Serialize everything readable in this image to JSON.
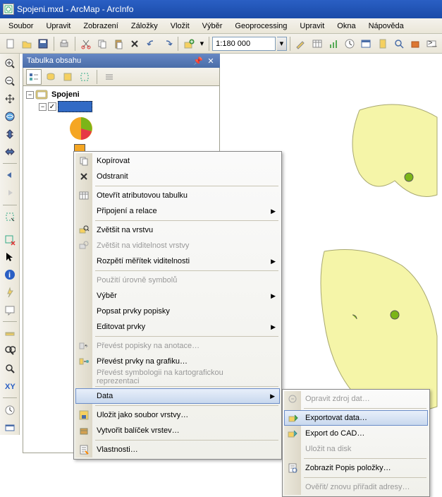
{
  "window": {
    "title": "Spojeni.mxd - ArcMap - ArcInfo"
  },
  "menubar": [
    "Soubor",
    "Upravit",
    "Zobrazení",
    "Záložky",
    "Vložit",
    "Výběr",
    "Geoprocessing",
    "Upravit",
    "Okna",
    "Nápověda"
  ],
  "toolbar": {
    "scale": "1:180 000"
  },
  "toc": {
    "title": "Tabulka obsahu",
    "root": "Spojeni",
    "layer": "",
    "legend": {
      "colors": [
        "#f5a623",
        "#e63946",
        "#7cb518"
      ]
    }
  },
  "context_menu1": {
    "items": [
      {
        "label": "Kopírovat",
        "icon": "copy-icon"
      },
      {
        "label": "Odstranit",
        "icon": "delete-icon"
      },
      {
        "sep": true
      },
      {
        "label": "Otevřít atributovou tabulku",
        "icon": "table-icon"
      },
      {
        "label": "Připojení a relace",
        "sub": true
      },
      {
        "sep": true
      },
      {
        "label": "Zvětšit na vrstvu",
        "icon": "zoom-layer-icon"
      },
      {
        "label": "Zvětšit na viditelnost vrstvy",
        "disabled": true,
        "icon": "zoom-vis-icon"
      },
      {
        "label": "Rozpětí měřítek viditelnosti",
        "sub": true
      },
      {
        "sep": true
      },
      {
        "label": "Použití úrovně symbolů",
        "disabled": true
      },
      {
        "label": "Výběr",
        "sub": true
      },
      {
        "label": "Popsat prvky popisky"
      },
      {
        "label": "Editovat prvky",
        "sub": true
      },
      {
        "sep": true
      },
      {
        "label": "Převést popisky na anotace…",
        "disabled": true,
        "icon": "convert-icon"
      },
      {
        "label": "Převést prvky na grafiku…",
        "icon": "convert2-icon"
      },
      {
        "label": "Převést symbologii na kartografickou reprezentaci",
        "disabled": true
      },
      {
        "sep": true
      },
      {
        "label": "Data",
        "sub": true,
        "hl": true
      },
      {
        "sep": true
      },
      {
        "label": "Uložit jako soubor vrstvy…",
        "icon": "save-layer-icon"
      },
      {
        "label": "Vytvořit balíček vrstev…",
        "icon": "package-icon"
      },
      {
        "sep": true
      },
      {
        "label": "Vlastnosti…",
        "icon": "props-icon"
      }
    ]
  },
  "context_menu2": {
    "items": [
      {
        "label": "Opravit zdroj dat…",
        "disabled": true,
        "icon": "repair-icon"
      },
      {
        "sep": true
      },
      {
        "label": "Exportovat data…",
        "hl": true,
        "icon": "export-icon"
      },
      {
        "label": "Export do CAD…",
        "icon": "export-cad-icon"
      },
      {
        "label": "Uložit na disk",
        "disabled": true
      },
      {
        "sep": true
      },
      {
        "label": "Zobrazit Popis položky…",
        "icon": "item-desc-icon"
      },
      {
        "sep": true
      },
      {
        "label": "Ověřit/ znovu přiřadit adresy…",
        "disabled": true
      }
    ]
  }
}
